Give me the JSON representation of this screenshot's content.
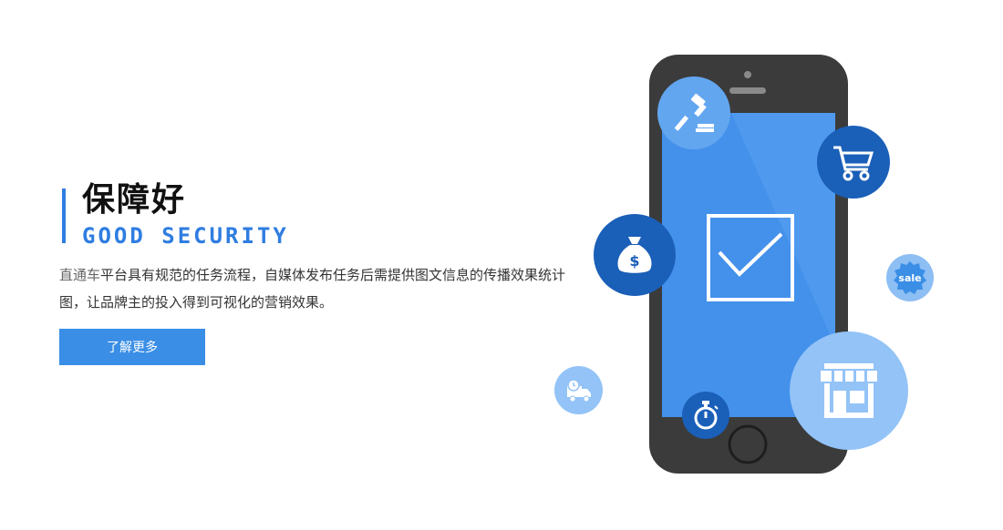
{
  "feature": {
    "title": "保障好",
    "subtitle": "GOOD SECURITY",
    "description_lead": "直通车",
    "description_rest": "平台具有规范的任务流程，自媒体发布任务后需提供图文信息的传播效果统计图，让品牌主的投入得到可视化的营销效果。",
    "button_label": "了解更多"
  },
  "illustration": {
    "sale_label": "sale",
    "dollar_label": "$",
    "icons": [
      "gavel-icon",
      "cart-icon",
      "money-bag-icon",
      "sale-badge-icon",
      "shop-icon",
      "stopwatch-icon",
      "delivery-truck-icon",
      "checkmark-icon"
    ]
  },
  "colors": {
    "accent": "#2f7de1",
    "button": "#3a8ee6",
    "dark_blue": "#1a5fb8",
    "light_blue": "#5aa0ee",
    "pale_blue": "#93c3f7",
    "phone_body": "#3b3b3b",
    "phone_screen": "#4391eb"
  }
}
